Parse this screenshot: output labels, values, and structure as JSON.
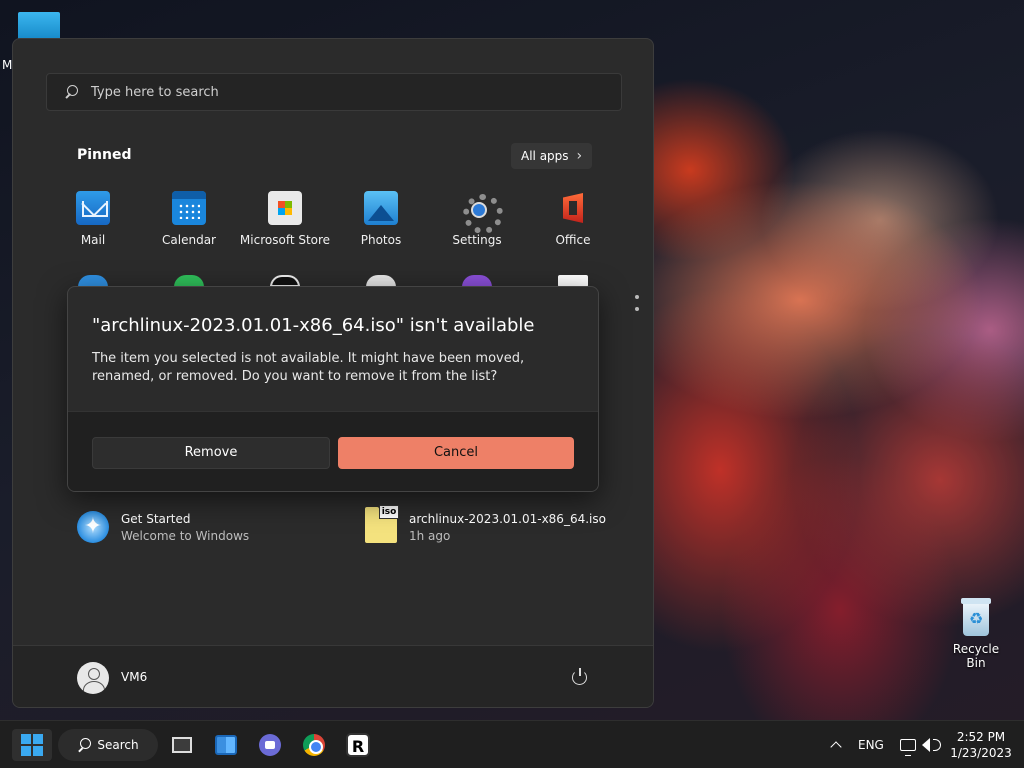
{
  "desktop": {
    "top_icon_label": "M",
    "recycle_bin_label": "Recycle Bin"
  },
  "start_menu": {
    "search_placeholder": "Type here to search",
    "pinned_title": "Pinned",
    "all_apps_label": "All apps",
    "pinned_apps": [
      {
        "label": "Mail",
        "icon": "mail-icon"
      },
      {
        "label": "Calendar",
        "icon": "calendar-icon"
      },
      {
        "label": "Microsoft Store",
        "icon": "store-icon"
      },
      {
        "label": "Photos",
        "icon": "photos-icon"
      },
      {
        "label": "Settings",
        "icon": "settings-icon"
      },
      {
        "label": "Office",
        "icon": "office-icon"
      }
    ],
    "recommended": [
      {
        "title": "Get Started",
        "subtitle": "Welcome to Windows",
        "icon": "get-started-icon"
      },
      {
        "title": "archlinux-2023.01.01-x86_64.iso",
        "subtitle": "1h ago",
        "icon": "iso-file-icon",
        "badge": "iso"
      }
    ],
    "user": {
      "name": "VM6"
    }
  },
  "dialog": {
    "title": "\"archlinux-2023.01.01-x86_64.iso\" isn't available",
    "message": "The item you selected is not available. It might have been moved, renamed, or removed. Do you want to remove it from the list?",
    "remove_label": "Remove",
    "cancel_label": "Cancel",
    "accent_color": "#ee8067"
  },
  "taskbar": {
    "search_label": "Search",
    "language": "ENG",
    "time": "2:52 PM",
    "date": "1/23/2023",
    "r_app_letter": "R"
  }
}
